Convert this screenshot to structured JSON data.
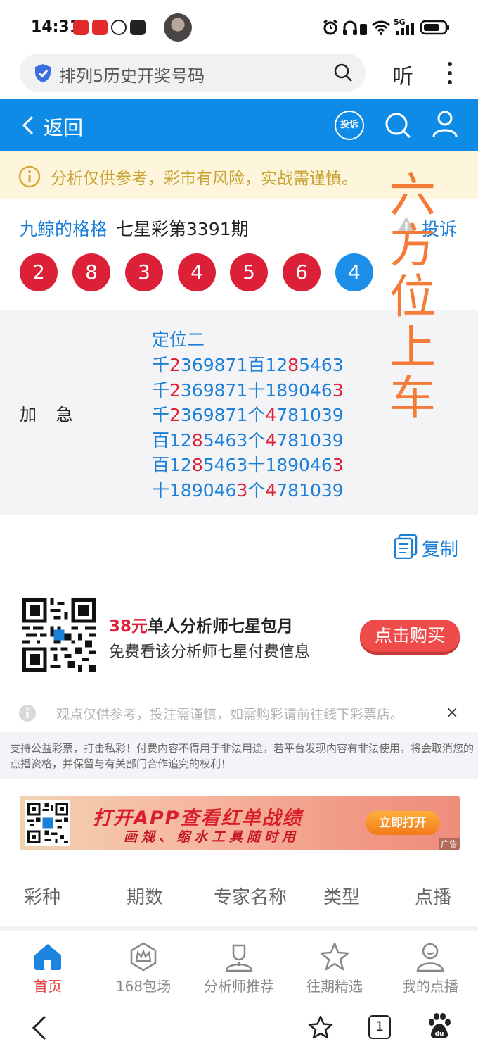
{
  "status_bar": {
    "time": "14:31",
    "network": "5G"
  },
  "browser": {
    "search_text": "排列5历史开奖号码",
    "listen_label": "听"
  },
  "header": {
    "back_label": "返回",
    "complain_icon_label": "投诉"
  },
  "warning": {
    "text": "分析仅供参考，彩市有风险，实战需谨慎。"
  },
  "article": {
    "author": "九鲸的格格",
    "title": "七星彩第3391期",
    "report_label": "投诉",
    "balls": [
      {
        "n": "2",
        "color": "red"
      },
      {
        "n": "8",
        "color": "red"
      },
      {
        "n": "3",
        "color": "red"
      },
      {
        "n": "4",
        "color": "red"
      },
      {
        "n": "5",
        "color": "red"
      },
      {
        "n": "6",
        "color": "red"
      },
      {
        "n": "4",
        "color": "blue"
      }
    ],
    "overlay_text": [
      "六",
      "方",
      "位",
      "上",
      "车"
    ],
    "urgent_label": "加 急",
    "heading": "定位二",
    "predictions": [
      [
        {
          "t": "千"
        },
        {
          "t": "2",
          "r": true
        },
        {
          "t": "369871百12"
        },
        {
          "t": "8",
          "r": true
        },
        {
          "t": "5463"
        }
      ],
      [
        {
          "t": "千"
        },
        {
          "t": "2",
          "r": true
        },
        {
          "t": "369871十189046"
        },
        {
          "t": "3",
          "r": true
        }
      ],
      [
        {
          "t": "千"
        },
        {
          "t": "2",
          "r": true
        },
        {
          "t": "369871个"
        },
        {
          "t": "4",
          "r": true
        },
        {
          "t": "781039"
        }
      ],
      [
        {
          "t": "百12"
        },
        {
          "t": "8",
          "r": true
        },
        {
          "t": "5463个"
        },
        {
          "t": "4",
          "r": true
        },
        {
          "t": "781039"
        }
      ],
      [
        {
          "t": "百12"
        },
        {
          "t": "8",
          "r": true
        },
        {
          "t": "5463十189046"
        },
        {
          "t": "3",
          "r": true
        }
      ],
      [
        {
          "t": "十189046"
        },
        {
          "t": "3",
          "r": true
        },
        {
          "t": "个"
        },
        {
          "t": "4",
          "r": true
        },
        {
          "t": "781039"
        }
      ]
    ],
    "copy_label": "复制"
  },
  "promo": {
    "price": "38元",
    "title_rest": "单人分析师七星包月",
    "subtitle": "免费看该分析师七星付费信息",
    "buy_label": "点击购买"
  },
  "notice": {
    "tip": "观点仅供参考，投注需谨慎，如需购彩请前往线下彩票店。",
    "close": "×",
    "legal": "支持公益彩票，打击私彩！付费内容不得用于非法用途，若平台发现内容有非法使用，将会取消您的点播资格，并保留与有关部门合作追究的权利！"
  },
  "banner": {
    "line1": "打开APP查看红单战绩",
    "line2": "画规、缩水工具随时用",
    "open_label": "立即打开",
    "ad_label": "广告"
  },
  "table_headers": [
    "彩种",
    "期数",
    "专家名称",
    "类型",
    "点播"
  ],
  "bottom_nav": [
    {
      "label": "首页",
      "icon": "home-icon",
      "active": true
    },
    {
      "label": "168包场",
      "icon": "crown-icon",
      "active": false
    },
    {
      "label": "分析师推荐",
      "icon": "analyst-icon",
      "active": false
    },
    {
      "label": "往期精选",
      "icon": "star-icon",
      "active": false
    },
    {
      "label": "我的点播",
      "icon": "user-icon",
      "active": false
    }
  ],
  "system_nav": {
    "tab_count": "1"
  },
  "colors": {
    "brand_blue": "#0d8be6",
    "ball_red": "#dc2038",
    "ball_blue": "#1e8fe8",
    "overlay_orange": "#f47b38"
  }
}
